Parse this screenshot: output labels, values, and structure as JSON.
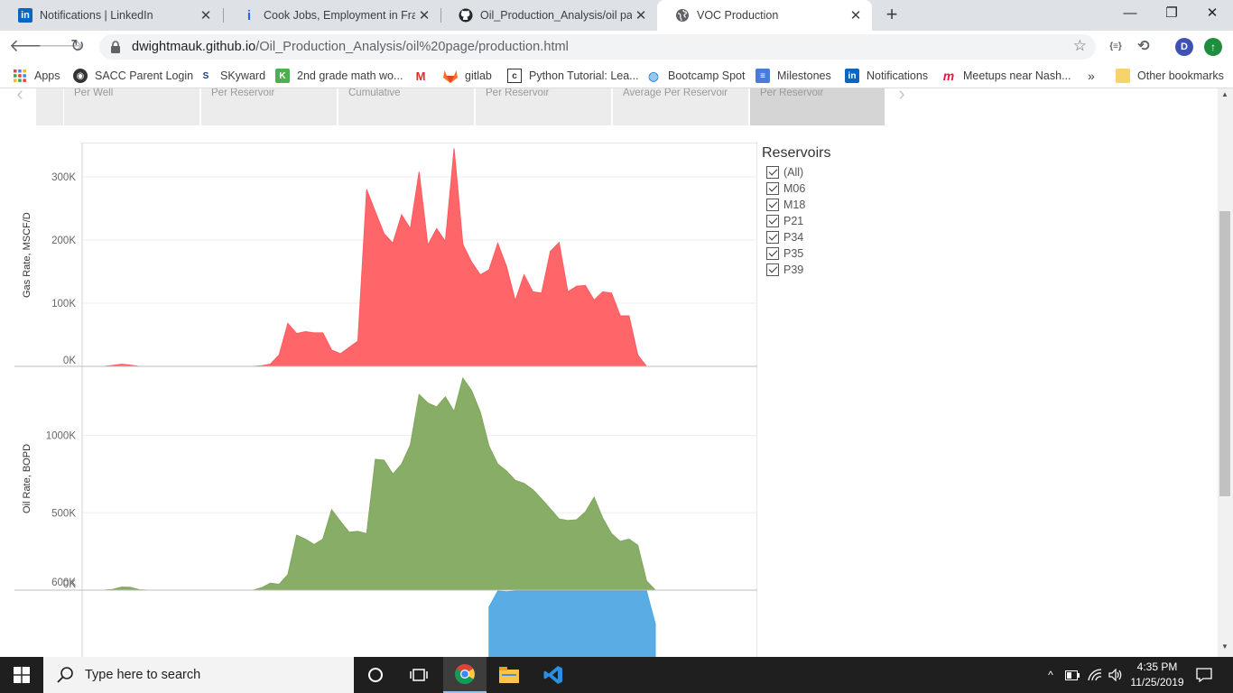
{
  "browser": {
    "tabs": [
      {
        "title": "Notifications | LinkedIn",
        "favicon": "linkedin-icon",
        "active": false
      },
      {
        "title": "Cook Jobs, Employment in Frankl",
        "favicon": "indeed-icon",
        "active": false
      },
      {
        "title": "Oil_Production_Analysis/oil page",
        "favicon": "github-icon",
        "active": false
      },
      {
        "title": "VOC Production",
        "favicon": "globe-icon",
        "active": true
      }
    ],
    "new_tab": "+",
    "url_host": "dwightmauk.github.io",
    "url_path": "/Oil_Production_Analysis/oil%20page/production.html",
    "profile_initial": "D",
    "extension_label": "{≡}",
    "bookmarks": [
      {
        "label": "Apps",
        "icon": "apps-grid-icon"
      },
      {
        "label": "SACC Parent Login",
        "icon": "sacc-icon"
      },
      {
        "label": "SKyward",
        "icon": "skyward-icon"
      },
      {
        "label": "2nd grade math wo...",
        "icon": "math-icon"
      },
      {
        "label": "",
        "icon": "gmail-icon"
      },
      {
        "label": "gitlab",
        "icon": "gitlab-icon"
      },
      {
        "label": "Python Tutorial: Lea...",
        "icon": "python-tutorial-icon"
      },
      {
        "label": "Bootcamp Spot",
        "icon": "bootcamp-icon"
      },
      {
        "label": "Milestones",
        "icon": "milestones-icon"
      },
      {
        "label": "Notifications",
        "icon": "linkedin-icon"
      },
      {
        "label": "Meetups near Nash...",
        "icon": "meetup-icon"
      }
    ],
    "bookmarks_overflow": "»",
    "other_bookmarks": "Other bookmarks"
  },
  "page": {
    "sheet_tabs": [
      {
        "label": "Per Well",
        "selected": false
      },
      {
        "label": "Per Reservoir",
        "selected": false
      },
      {
        "label": "Cumulative",
        "selected": false
      },
      {
        "label": "Per Reservoir",
        "selected": false
      },
      {
        "label": "Average Per Reservoir",
        "selected": false
      },
      {
        "label": "Per Reservoir",
        "selected": true
      }
    ],
    "filter": {
      "title": "Reservoirs",
      "items": [
        "(All)",
        "M06",
        "M18",
        "P21",
        "P34",
        "P35",
        "P39"
      ]
    }
  },
  "chart_data": [
    {
      "type": "area",
      "ylabel": "Gas Rate, MSCF/D",
      "color": "#ff5a5f",
      "ylim": [
        0,
        350000
      ],
      "yticks": [
        0,
        100000,
        200000,
        300000
      ],
      "ytick_labels": [
        "0K",
        "100K",
        "200K",
        "300K"
      ],
      "x": [
        0,
        1,
        2,
        3,
        4,
        5,
        6,
        7,
        8,
        9,
        10,
        11,
        12,
        13,
        14,
        15,
        16,
        17,
        18,
        19,
        20,
        21,
        22,
        23,
        24,
        25,
        26,
        27,
        28,
        29,
        30,
        31,
        32,
        33,
        34,
        35,
        36,
        37,
        38,
        39,
        40,
        41,
        42,
        43,
        44,
        45,
        46,
        47,
        48,
        49,
        50,
        51,
        52,
        53,
        54,
        55,
        56,
        57,
        58,
        59,
        60,
        61,
        62,
        63,
        64,
        65
      ],
      "values": [
        0,
        0,
        0,
        1500,
        3500,
        2000,
        0,
        0,
        0,
        0,
        0,
        0,
        0,
        0,
        0,
        0,
        0,
        0,
        0,
        0,
        1000,
        3500,
        18000,
        68000,
        52000,
        55000,
        53000,
        53000,
        26000,
        20000,
        30000,
        40000,
        280000,
        245000,
        210000,
        195000,
        240000,
        218000,
        308000,
        192000,
        218000,
        198000,
        345000,
        193000,
        165000,
        145000,
        153000,
        195000,
        158000,
        104000,
        145000,
        118000,
        116000,
        182000,
        196000,
        118000,
        127000,
        128000,
        105000,
        118000,
        116000,
        80000,
        80000,
        18000,
        0,
        0
      ]
    },
    {
      "type": "area",
      "ylabel": "Oil Rate, BOPD",
      "color": "#7fa75a",
      "ylim": [
        0,
        1400000
      ],
      "yticks": [
        0,
        500000,
        1000000
      ],
      "ytick_labels": [
        "0K",
        "500K",
        "1000K"
      ],
      "x": [
        0,
        1,
        2,
        3,
        4,
        5,
        6,
        7,
        8,
        9,
        10,
        11,
        12,
        13,
        14,
        15,
        16,
        17,
        18,
        19,
        20,
        21,
        22,
        23,
        24,
        25,
        26,
        27,
        28,
        29,
        30,
        31,
        32,
        33,
        34,
        35,
        36,
        37,
        38,
        39,
        40,
        41,
        42,
        43,
        44,
        45,
        46,
        47,
        48,
        49,
        50,
        51,
        52,
        53,
        54,
        55,
        56,
        57,
        58,
        59,
        60,
        61,
        62,
        63,
        64,
        65
      ],
      "values": [
        0,
        0,
        0,
        5000,
        20000,
        18000,
        3000,
        0,
        0,
        0,
        0,
        0,
        0,
        0,
        0,
        0,
        0,
        0,
        0,
        0,
        15000,
        45000,
        38000,
        100000,
        355000,
        330000,
        295000,
        330000,
        520000,
        445000,
        375000,
        380000,
        365000,
        845000,
        840000,
        750000,
        815000,
        940000,
        1265000,
        1210000,
        1185000,
        1250000,
        1155000,
        1370000,
        1290000,
        1150000,
        930000,
        815000,
        770000,
        710000,
        690000,
        650000,
        590000,
        525000,
        460000,
        450000,
        455000,
        505000,
        600000,
        465000,
        365000,
        315000,
        330000,
        290000,
        60000,
        0
      ]
    },
    {
      "type": "area",
      "color": "#4ea7e2",
      "yticks": [
        600000
      ],
      "ytick_labels": [
        "600K"
      ],
      "x": [
        46,
        47,
        48,
        49,
        50,
        51,
        52,
        53,
        54,
        55,
        56,
        57,
        58,
        59,
        60,
        61,
        62,
        63,
        64,
        65
      ],
      "values": [
        420000,
        580000,
        530000,
        620000,
        625000,
        660000,
        640000,
        630000,
        600000,
        640000,
        640000,
        620000,
        600000,
        560000,
        540000,
        560000,
        660000,
        600000,
        570000,
        300000
      ]
    }
  ],
  "taskbar": {
    "search_placeholder": "Type here to search",
    "time": "4:35 PM",
    "date": "11/25/2019"
  }
}
